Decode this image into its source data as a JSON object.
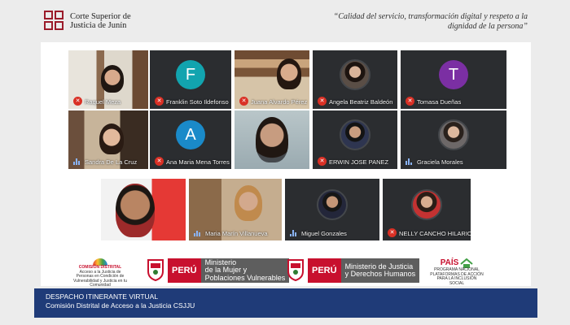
{
  "header": {
    "institution_line1": "Corte Superior de",
    "institution_line2": "Justicia de Junín",
    "motto": "“Calidad del servicio, transformación digital y respeto a la dignidad de la persona”"
  },
  "participants": [
    {
      "name": "Raquel Meza",
      "status": "muted"
    },
    {
      "name": "Franklin Soto Ildefonso",
      "status": "muted",
      "avatar_letter": "F",
      "avatar_color": "#12a4af"
    },
    {
      "name": "Juana Alvardo Pérez",
      "status": "muted"
    },
    {
      "name": "Angela Beatriz Baldeón",
      "status": "muted"
    },
    {
      "name": "Tomasa Dueñas",
      "status": "muted",
      "avatar_letter": "T",
      "avatar_color": "#7b2fa3"
    },
    {
      "name": "Sandra De La Cruz",
      "status": "speaking"
    },
    {
      "name": "Ana Maria Mena Torres",
      "status": "muted",
      "avatar_letter": "A",
      "avatar_color": "#1a8ac9"
    },
    {
      "name": "ERWIN JOSE PANEZ",
      "status": "muted"
    },
    {
      "name": "Graciela Morales",
      "status": "speaking"
    },
    {
      "name": "Maria Marín Villanueva",
      "status": "speaking"
    },
    {
      "name": "Miguel Gonzales",
      "status": "speaking"
    },
    {
      "name": "NELLY CANCHO HILARIO",
      "status": "muted"
    }
  ],
  "sponsors": {
    "brand_country": "PERÚ",
    "ministry1_line1": "Ministerio",
    "ministry1_line2": "de la Mujer y",
    "ministry1_line3": "Poblaciones Vulnerables",
    "ministry2_line1": "Ministerio de Justicia",
    "ministry2_line2": "y Derechos Humanos",
    "commission_title": "COMISIÓN DISTRITAL",
    "commission_text": "Acceso a la Justicia de Personas en Condición de Vulnerabilidad y Justicia en tu Comunidad",
    "pais_name": "PAÍS",
    "pais_text": "PROGRAMA NACIONAL PLATAFORMAS DE ACCIÓN PARA LA INCLUSIÓN SOCIAL"
  },
  "banner": {
    "line1": "DESPACHO ITINERANTE VIRTUAL",
    "line2": "Comisión Distrital de Acceso a la Justicia CSJJU"
  },
  "colors": {
    "brand_red": "#9b1b2a",
    "banner_blue": "#1f3b78",
    "meet_tile": "#2b2d30",
    "muted_red": "#d93025"
  }
}
